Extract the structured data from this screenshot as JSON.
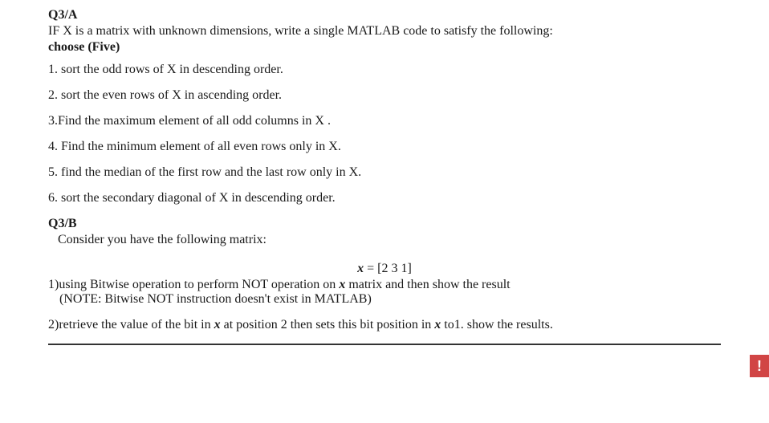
{
  "q3a": {
    "label": "Q3/A",
    "intro": "IF X is a matrix with unknown dimensions, write a single MATLAB code  to satisfy the following:",
    "choose": "choose (Five)",
    "items": [
      "1. sort the odd rows of X in descending order.",
      "2. sort the even rows   of X in ascending order.",
      "3.Find the maximum element of all odd columns in X .",
      "4. Find the minimum element of all even rows only in X.",
      "5. find the median of the first row and the last row only in X.",
      "6. sort the secondary diagonal of X in descending order."
    ]
  },
  "q3b": {
    "label": "Q3/B",
    "intro": "Consider you have the following matrix:",
    "matrix_var": "x",
    "matrix_eq": " = [2  3  1]",
    "item1_pre": "1)using Bitwise operation to perform NOT operation on ",
    "item1_var": "x",
    "item1_post": " matrix and then show the result",
    "item1_note": "(NOTE: Bitwise NOT instruction doesn't exist in MATLAB)",
    "item2_pre": "2)retrieve the value of the bit in ",
    "item2_var1": "x",
    "item2_mid": " at position 2 then sets this bit position in ",
    "item2_var2": "x",
    "item2_post": " to1. show the results."
  },
  "badge": {
    "text": "!"
  }
}
